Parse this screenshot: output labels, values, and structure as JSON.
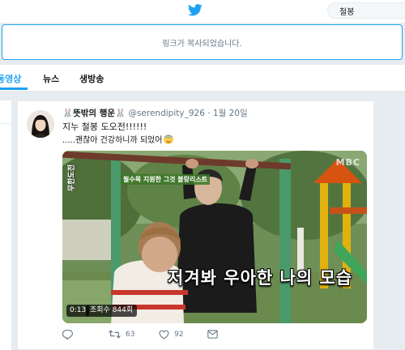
{
  "search": {
    "value": "철봉"
  },
  "toast": {
    "message": "링크가 복사되었습니다."
  },
  "nav": {
    "items": [
      {
        "label": "동영상",
        "active": true
      },
      {
        "label": "뉴스",
        "active": false
      },
      {
        "label": "생방송",
        "active": false
      }
    ]
  },
  "tweet": {
    "display_name": "🐰뜻밖의 행운🐰",
    "handle": "@serendipity_926",
    "dot": "·",
    "timestamp": "1월 20일",
    "text_line1": "지누 철봉 도오전!!!!!!",
    "text_line2": ".....괜찮아 건강하니까 되었어",
    "emoji_icon": "smiling-face-with-halo",
    "video": {
      "duration": "0:13",
      "views": "조회수 844회",
      "watermark": "MBC",
      "caption": "저겨봐 우아한 나의 모습",
      "tag": "월수목 지원한 그것 블랑리스트"
    },
    "actions": {
      "reply_icon": "reply-icon",
      "retweet_count": "63",
      "like_count": "92",
      "dm_icon": "envelope-icon"
    }
  },
  "colors": {
    "accent": "#1da1f2",
    "background": "#e6ecf0",
    "secondary_text": "#657786"
  }
}
